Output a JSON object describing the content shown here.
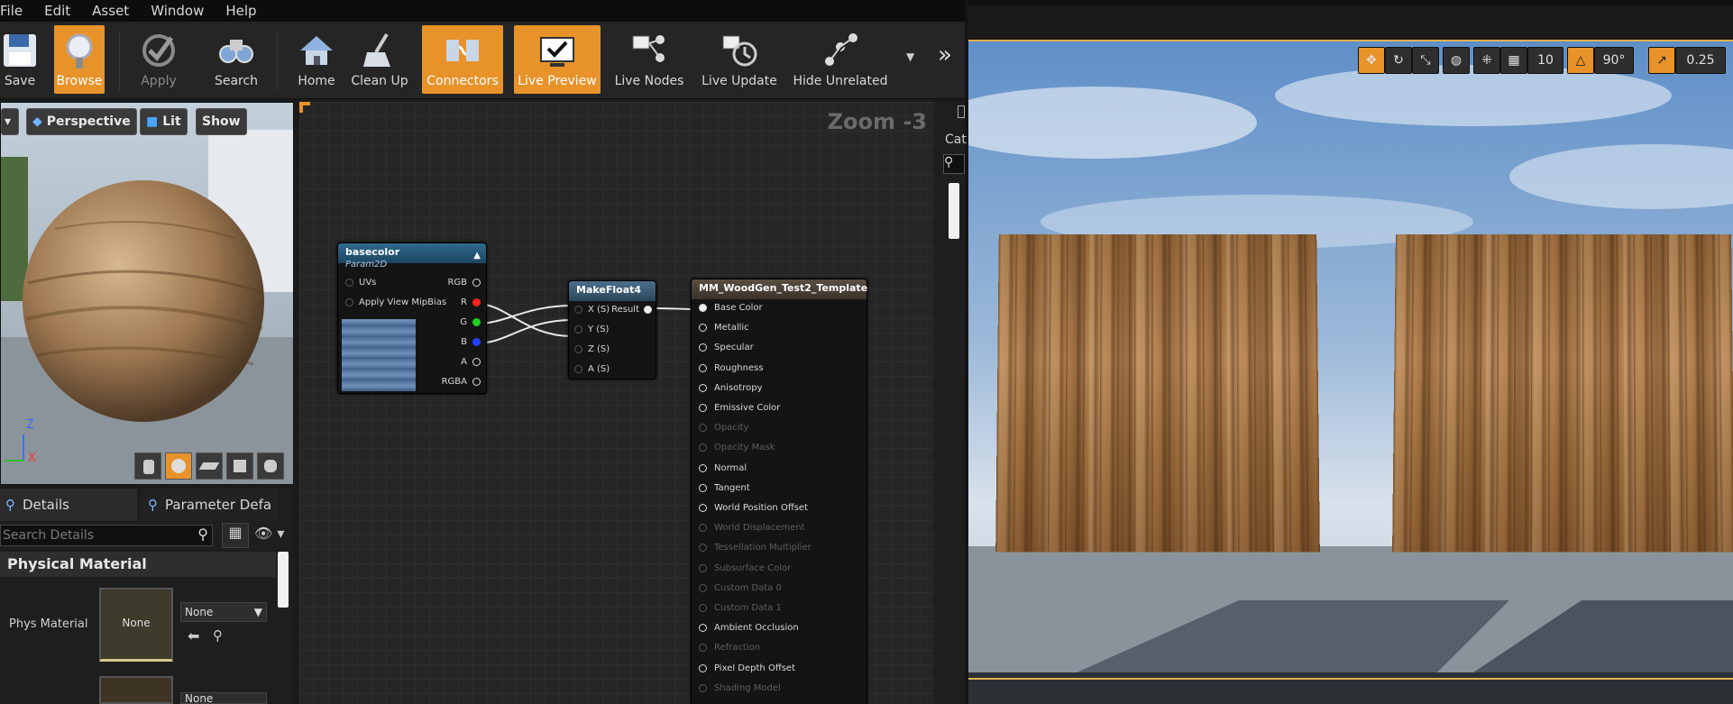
{
  "menu": [
    "File",
    "Edit",
    "Asset",
    "Window",
    "Help"
  ],
  "toolbar": {
    "buttons": [
      {
        "label": "Save"
      },
      {
        "label": "Browse"
      },
      {
        "label": "Apply"
      },
      {
        "label": "Search"
      },
      {
        "label": "Home"
      },
      {
        "label": "Clean Up"
      },
      {
        "label": "Connectors"
      },
      {
        "label": "Live Preview"
      },
      {
        "label": "Live Nodes"
      },
      {
        "label": "Live Update"
      },
      {
        "label": "Hide Unrelated"
      }
    ]
  },
  "preview": {
    "perspective": "Perspective",
    "lit": "Lit",
    "show": "Show",
    "axis_z": "Z",
    "axis_x": "X"
  },
  "details": {
    "tab_details": "Details",
    "tab_params": "Parameter Defa",
    "search_placeholder": "Search Details",
    "section": "Physical Material",
    "phys_label": "Phys Material",
    "thumb_none": "None",
    "dropdown_none": "None",
    "dropdown_none2": "None"
  },
  "graph": {
    "zoom": "Zoom -3",
    "param_node": {
      "title": "basecolor",
      "subtitle": "Param2D",
      "in_pins": [
        "UVs",
        "Apply View MipBias"
      ],
      "out_pins": [
        "RGB",
        "R",
        "G",
        "B",
        "A",
        "RGBA"
      ]
    },
    "make_node": {
      "title": "MakeFloat4",
      "in_pins": [
        "X (S)",
        "Y (S)",
        "Z (S)",
        "A (S)"
      ],
      "out_pin": "Result"
    },
    "material_node": {
      "title": "MM_WoodGen_Test2_Template",
      "pins": [
        {
          "label": "Base Color",
          "enabled": true
        },
        {
          "label": "Metallic",
          "enabled": true
        },
        {
          "label": "Specular",
          "enabled": true
        },
        {
          "label": "Roughness",
          "enabled": true
        },
        {
          "label": "Anisotropy",
          "enabled": true
        },
        {
          "label": "Emissive Color",
          "enabled": true
        },
        {
          "label": "Opacity",
          "enabled": false
        },
        {
          "label": "Opacity Mask",
          "enabled": false
        },
        {
          "label": "Normal",
          "enabled": true
        },
        {
          "label": "Tangent",
          "enabled": true
        },
        {
          "label": "World Position Offset",
          "enabled": true
        },
        {
          "label": "World Displacement",
          "enabled": false
        },
        {
          "label": "Tessellation Multiplier",
          "enabled": false
        },
        {
          "label": "Subsurface Color",
          "enabled": false
        },
        {
          "label": "Custom Data 0",
          "enabled": false
        },
        {
          "label": "Custom Data 1",
          "enabled": false
        },
        {
          "label": "Ambient Occlusion",
          "enabled": true
        },
        {
          "label": "Refraction",
          "enabled": false
        },
        {
          "label": "Pixel Depth Offset",
          "enabled": true
        },
        {
          "label": "Shading Model",
          "enabled": false
        }
      ]
    }
  },
  "right_panel": {
    "cat_label": "Cat"
  },
  "scene": {
    "grid_snap": "10",
    "rot_snap": "90°",
    "scale_snap": "0.25"
  },
  "colors": {
    "accent": "#e8922a",
    "pin_r": "#ff2020",
    "pin_g": "#20d020",
    "pin_b": "#2040ff"
  }
}
